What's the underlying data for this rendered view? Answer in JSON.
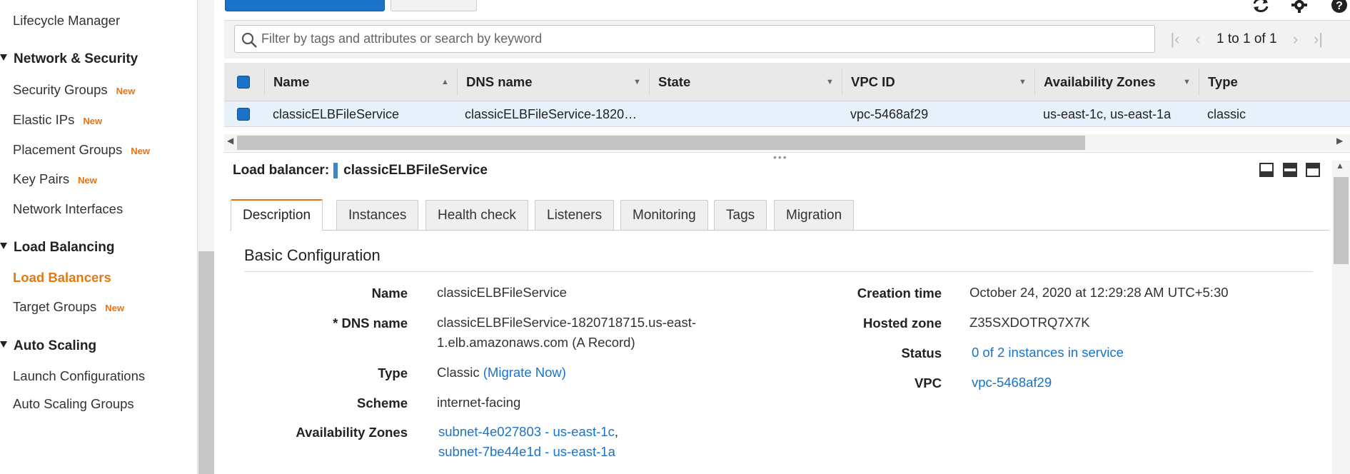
{
  "sidebar": {
    "lifecycle_manager": "Lifecycle Manager",
    "network_security": {
      "heading": "Network & Security",
      "items": [
        {
          "label": "Security Groups",
          "badge": "New"
        },
        {
          "label": "Elastic IPs",
          "badge": "New"
        },
        {
          "label": "Placement Groups",
          "badge": "New"
        },
        {
          "label": "Key Pairs",
          "badge": "New"
        },
        {
          "label": "Network Interfaces"
        }
      ]
    },
    "load_balancing": {
      "heading": "Load Balancing",
      "items": [
        {
          "label": "Load Balancers"
        },
        {
          "label": "Target Groups",
          "badge": "New"
        }
      ]
    },
    "auto_scaling": {
      "heading": "Auto Scaling",
      "items": [
        {
          "label": "Launch Configurations"
        },
        {
          "label": "Auto Scaling Groups"
        }
      ]
    }
  },
  "toolbar": {
    "refresh_icon": "refresh-icon",
    "settings_icon": "gear-icon",
    "help_icon": "help-icon"
  },
  "filter": {
    "placeholder": "Filter by tags and attributes or search by keyword",
    "pager_text": "1 to 1 of 1"
  },
  "table": {
    "columns": [
      "Name",
      "DNS name",
      "State",
      "VPC ID",
      "Availability Zones",
      "Type"
    ],
    "rows": [
      {
        "name": "classicELBFileService",
        "dns": "classicELBFileService-1820…",
        "state": "",
        "vpc": "vpc-5468af29",
        "azs": "us-east-1c, us-east-1a",
        "type": "classic"
      }
    ]
  },
  "detail": {
    "title_prefix": "Load balancer:",
    "title_name": "classicELBFileService",
    "tabs": [
      "Description",
      "Instances",
      "Health check",
      "Listeners",
      "Monitoring",
      "Tags",
      "Migration"
    ],
    "active_tab": "Description",
    "section_title": "Basic Configuration",
    "left": {
      "name_label": "Name",
      "name_value": "classicELBFileService",
      "dns_label": "* DNS name",
      "dns_value_line1": "classicELBFileService-1820718715.us-east-",
      "dns_value_line2": "1.elb.amazonaws.com (A Record)",
      "type_label": "Type",
      "type_value": "Classic",
      "type_link": "(Migrate Now)",
      "scheme_label": "Scheme",
      "scheme_value": "internet-facing",
      "az_label": "Availability Zones",
      "az_line1": "subnet-4e027803 - us-east-1c",
      "az_sep": ",",
      "az_line2": "subnet-7be44e1d - us-east-1a"
    },
    "right": {
      "creation_label": "Creation time",
      "creation_value": "October 24, 2020 at 12:29:28 AM UTC+5:30",
      "hosted_label": "Hosted zone",
      "hosted_value": "Z35SXDOTRQ7X7K",
      "status_label": "Status",
      "status_value": "0 of 2 instances in service",
      "vpc_label": "VPC",
      "vpc_value": "vpc-5468af29"
    }
  },
  "colors": {
    "accent_blue": "#1a73c8",
    "active_orange": "#e47911",
    "badge_orange": "#ec7211"
  }
}
